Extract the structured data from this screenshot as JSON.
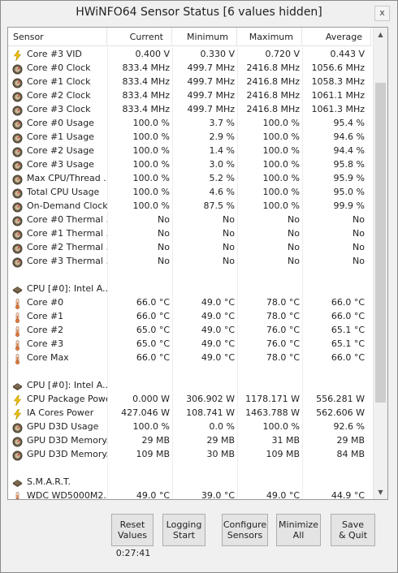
{
  "window": {
    "title": "HWiNFO64 Sensor Status [6 values hidden]",
    "close_label": "x"
  },
  "columns": [
    "Sensor",
    "Current",
    "Minimum",
    "Maximum",
    "Average"
  ],
  "rows": [
    {
      "icon": "bolt-icon",
      "label": "Core #3 VID",
      "current": "0.400 V",
      "minimum": "0.330 V",
      "maximum": "0.720 V",
      "average": "0.443 V"
    },
    {
      "icon": "gauge-icon",
      "label": "Core #0 Clock",
      "current": "833.4 MHz",
      "minimum": "499.7 MHz",
      "maximum": "2416.8 MHz",
      "average": "1056.6 MHz"
    },
    {
      "icon": "gauge-icon",
      "label": "Core #1 Clock",
      "current": "833.4 MHz",
      "minimum": "499.7 MHz",
      "maximum": "2416.8 MHz",
      "average": "1058.3 MHz"
    },
    {
      "icon": "gauge-icon",
      "label": "Core #2 Clock",
      "current": "833.4 MHz",
      "minimum": "499.7 MHz",
      "maximum": "2416.8 MHz",
      "average": "1061.1 MHz"
    },
    {
      "icon": "gauge-icon",
      "label": "Core #3 Clock",
      "current": "833.4 MHz",
      "minimum": "499.7 MHz",
      "maximum": "2416.8 MHz",
      "average": "1061.3 MHz"
    },
    {
      "icon": "gauge-icon",
      "label": "Core #0 Usage",
      "current": "100.0 %",
      "minimum": "3.7 %",
      "maximum": "100.0 %",
      "average": "95.4 %"
    },
    {
      "icon": "gauge-icon",
      "label": "Core #1 Usage",
      "current": "100.0 %",
      "minimum": "2.9 %",
      "maximum": "100.0 %",
      "average": "94.6 %"
    },
    {
      "icon": "gauge-icon",
      "label": "Core #2 Usage",
      "current": "100.0 %",
      "minimum": "1.4 %",
      "maximum": "100.0 %",
      "average": "94.4 %"
    },
    {
      "icon": "gauge-icon",
      "label": "Core #3 Usage",
      "current": "100.0 %",
      "minimum": "3.0 %",
      "maximum": "100.0 %",
      "average": "95.8 %"
    },
    {
      "icon": "gauge-icon",
      "label": "Max CPU/Thread ...",
      "current": "100.0 %",
      "minimum": "5.2 %",
      "maximum": "100.0 %",
      "average": "95.9 %"
    },
    {
      "icon": "gauge-icon",
      "label": "Total CPU Usage",
      "current": "100.0 %",
      "minimum": "4.6 %",
      "maximum": "100.0 %",
      "average": "95.0 %"
    },
    {
      "icon": "gauge-icon",
      "label": "On-Demand Clock...",
      "current": "100.0 %",
      "minimum": "87.5 %",
      "maximum": "100.0 %",
      "average": "99.9 %"
    },
    {
      "icon": "gauge-icon",
      "label": "Core #0 Thermal ...",
      "current": "No",
      "minimum": "No",
      "maximum": "No",
      "average": "No"
    },
    {
      "icon": "gauge-icon",
      "label": "Core #1 Thermal ...",
      "current": "No",
      "minimum": "No",
      "maximum": "No",
      "average": "No"
    },
    {
      "icon": "gauge-icon",
      "label": "Core #2 Thermal ...",
      "current": "No",
      "minimum": "No",
      "maximum": "No",
      "average": "No"
    },
    {
      "icon": "gauge-icon",
      "label": "Core #3 Thermal ...",
      "current": "No",
      "minimum": "No",
      "maximum": "No",
      "average": "No"
    },
    {
      "icon": "",
      "label": "",
      "current": "",
      "minimum": "",
      "maximum": "",
      "average": ""
    },
    {
      "icon": "chip-icon",
      "label": "CPU [#0]: Intel A...",
      "current": "",
      "minimum": "",
      "maximum": "",
      "average": ""
    },
    {
      "icon": "thermometer-icon",
      "label": "Core #0",
      "current": "66.0 °C",
      "minimum": "49.0 °C",
      "maximum": "78.0 °C",
      "average": "66.0 °C"
    },
    {
      "icon": "thermometer-icon",
      "label": "Core #1",
      "current": "66.0 °C",
      "minimum": "49.0 °C",
      "maximum": "78.0 °C",
      "average": "66.0 °C"
    },
    {
      "icon": "thermometer-icon",
      "label": "Core #2",
      "current": "65.0 °C",
      "minimum": "49.0 °C",
      "maximum": "76.0 °C",
      "average": "65.1 °C"
    },
    {
      "icon": "thermometer-icon",
      "label": "Core #3",
      "current": "65.0 °C",
      "minimum": "49.0 °C",
      "maximum": "76.0 °C",
      "average": "65.1 °C"
    },
    {
      "icon": "thermometer-icon",
      "label": "Core Max",
      "current": "66.0 °C",
      "minimum": "49.0 °C",
      "maximum": "78.0 °C",
      "average": "66.0 °C"
    },
    {
      "icon": "",
      "label": "",
      "current": "",
      "minimum": "",
      "maximum": "",
      "average": ""
    },
    {
      "icon": "chip-icon",
      "label": "CPU [#0]: Intel A...",
      "current": "",
      "minimum": "",
      "maximum": "",
      "average": ""
    },
    {
      "icon": "bolt-icon",
      "label": "CPU Package Power",
      "current": "0.000 W",
      "minimum": "306.902 W",
      "maximum": "1178.171 W",
      "average": "556.281 W"
    },
    {
      "icon": "bolt-icon",
      "label": "IA Cores Power",
      "current": "427.046 W",
      "minimum": "108.741 W",
      "maximum": "1463.788 W",
      "average": "562.606 W"
    },
    {
      "icon": "gauge-icon",
      "label": "GPU D3D Usage",
      "current": "100.0 %",
      "minimum": "0.0 %",
      "maximum": "100.0 %",
      "average": "92.6 %"
    },
    {
      "icon": "gauge-icon",
      "label": "GPU D3D Memory...",
      "current": "29 MB",
      "minimum": "29 MB",
      "maximum": "31 MB",
      "average": "29 MB"
    },
    {
      "icon": "gauge-icon",
      "label": "GPU D3D Memory...",
      "current": "109 MB",
      "minimum": "30 MB",
      "maximum": "109 MB",
      "average": "84 MB"
    },
    {
      "icon": "",
      "label": "",
      "current": "",
      "minimum": "",
      "maximum": "",
      "average": ""
    },
    {
      "icon": "chip-icon",
      "label": "S.M.A.R.T.",
      "current": "",
      "minimum": "",
      "maximum": "",
      "average": ""
    },
    {
      "icon": "thermometer-icon",
      "label": "WDC WD5000M2...",
      "current": "49.0 °C",
      "minimum": "39.0 °C",
      "maximum": "49.0 °C",
      "average": "44.9 °C"
    }
  ],
  "buttons": {
    "reset": "Reset\nValues",
    "logging": "Logging\nStart",
    "configure": "Configure\nSensors",
    "minimize": "Minimize\nAll",
    "save": "Save\n& Quit"
  },
  "timer": "0:27:41",
  "colors": {
    "bolt": "#f2c200",
    "gauge": "#6b5e4a",
    "thermometer": "#e07a3c",
    "chip": "#7a6850"
  }
}
